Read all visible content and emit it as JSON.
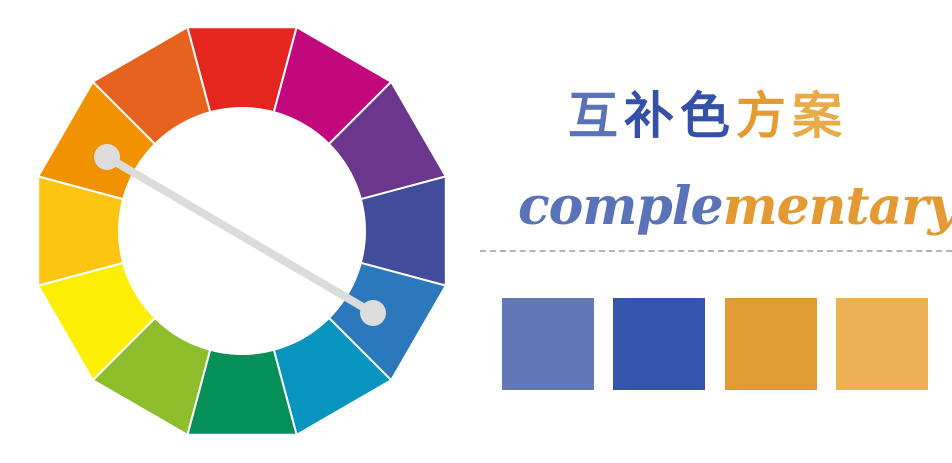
{
  "title_cn": {
    "chars": [
      {
        "text": "互",
        "color": "#5a73b8"
      },
      {
        "text": "补",
        "color": "#3650a8"
      },
      {
        "text": "色",
        "color": "#3650a8"
      },
      {
        "text": "方",
        "color": "#e39a32"
      },
      {
        "text": "案",
        "color": "#e9ab47"
      }
    ]
  },
  "title_en": {
    "part1": {
      "text": "comple",
      "color": "#5a73b8"
    },
    "part2": {
      "text": "mentary",
      "color": "#e39a32"
    }
  },
  "color_wheel": {
    "segments": [
      {
        "name": "red",
        "color": "#e42520"
      },
      {
        "name": "magenta",
        "color": "#c3087e"
      },
      {
        "name": "purple",
        "color": "#6a378c"
      },
      {
        "name": "indigo",
        "color": "#414d9a"
      },
      {
        "name": "blue",
        "color": "#2b78bd"
      },
      {
        "name": "cyan",
        "color": "#0795c0"
      },
      {
        "name": "green",
        "color": "#049057"
      },
      {
        "name": "yellow-green",
        "color": "#8ebe2b"
      },
      {
        "name": "yellow",
        "color": "#fdee06"
      },
      {
        "name": "yellow-orange",
        "color": "#fdc511"
      },
      {
        "name": "orange",
        "color": "#f19201"
      },
      {
        "name": "red-orange",
        "color": "#e7611f"
      }
    ],
    "connector_color": "#dcdcdc",
    "selected": [
      "orange",
      "blue"
    ]
  },
  "swatches": [
    {
      "color": "#6277b5"
    },
    {
      "color": "#3655ac"
    },
    {
      "color": "#e29b33"
    },
    {
      "color": "#ecb152"
    }
  ]
}
